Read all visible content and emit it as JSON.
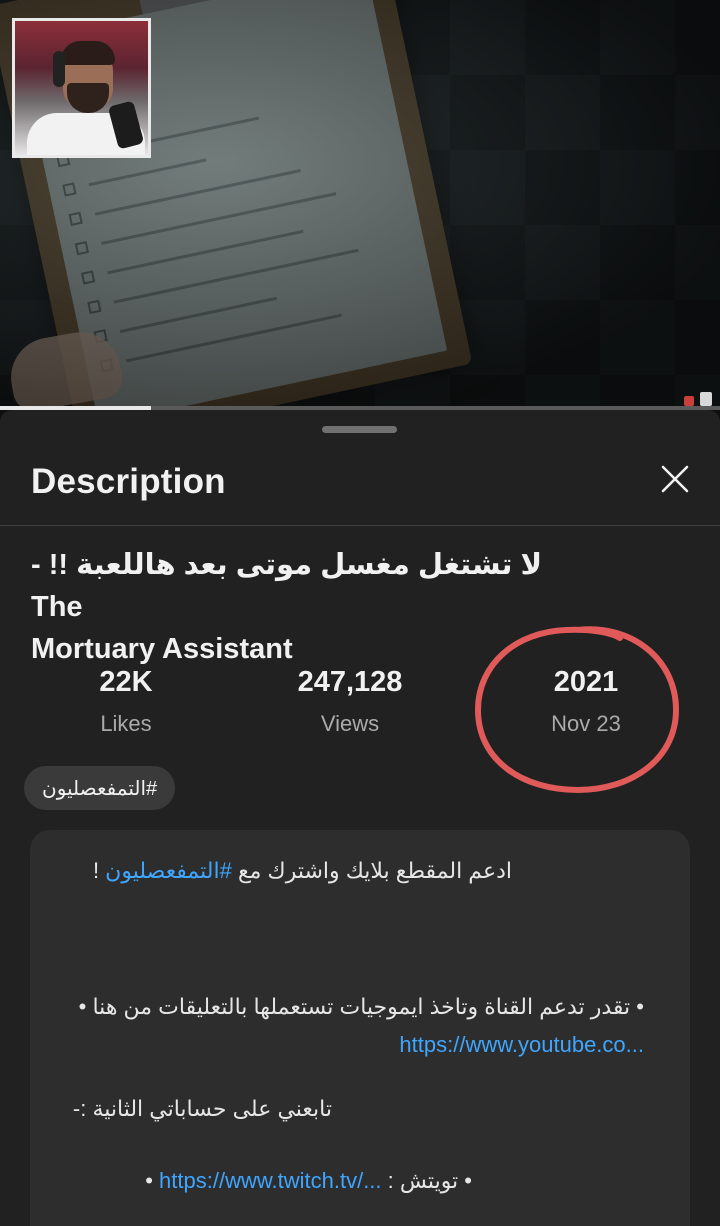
{
  "sheet": {
    "title": "Description",
    "video_title_line1": "لا تشتغل مغسل موتى بعد هاللعبة !! - The",
    "video_title_line2": "Mortuary Assistant"
  },
  "stats": {
    "likes_value": "22K",
    "likes_label": "Likes",
    "views_value": "247,128",
    "views_label": "Views",
    "year_value": "2021",
    "date_label": "Nov 23"
  },
  "hashtag": "#التمفعصليون",
  "description": {
    "line1_text": "ادعم المقطع بلايك واشترك مع ",
    "line1_tag": "#التمفعصليون",
    "line1_end": " !",
    "line2": "• تقدر تدعم القناة وتاخذ ايموجيات تستعملها بالتعليقات من هنا •",
    "line3_link": "https://www.youtube.co...",
    "line4": "تابعني على حساباتي الثانية :-",
    "line5_prefix": "• تويتش : ",
    "line5_link": "https://www.twitch.tv/...",
    "line5_end": " •"
  },
  "colors": {
    "background": "#0f0f0f",
    "sheet": "#212121",
    "link": "#3ea6ff",
    "annotation_circle": "#e05a5a"
  },
  "icons": {
    "close": "close-icon"
  }
}
